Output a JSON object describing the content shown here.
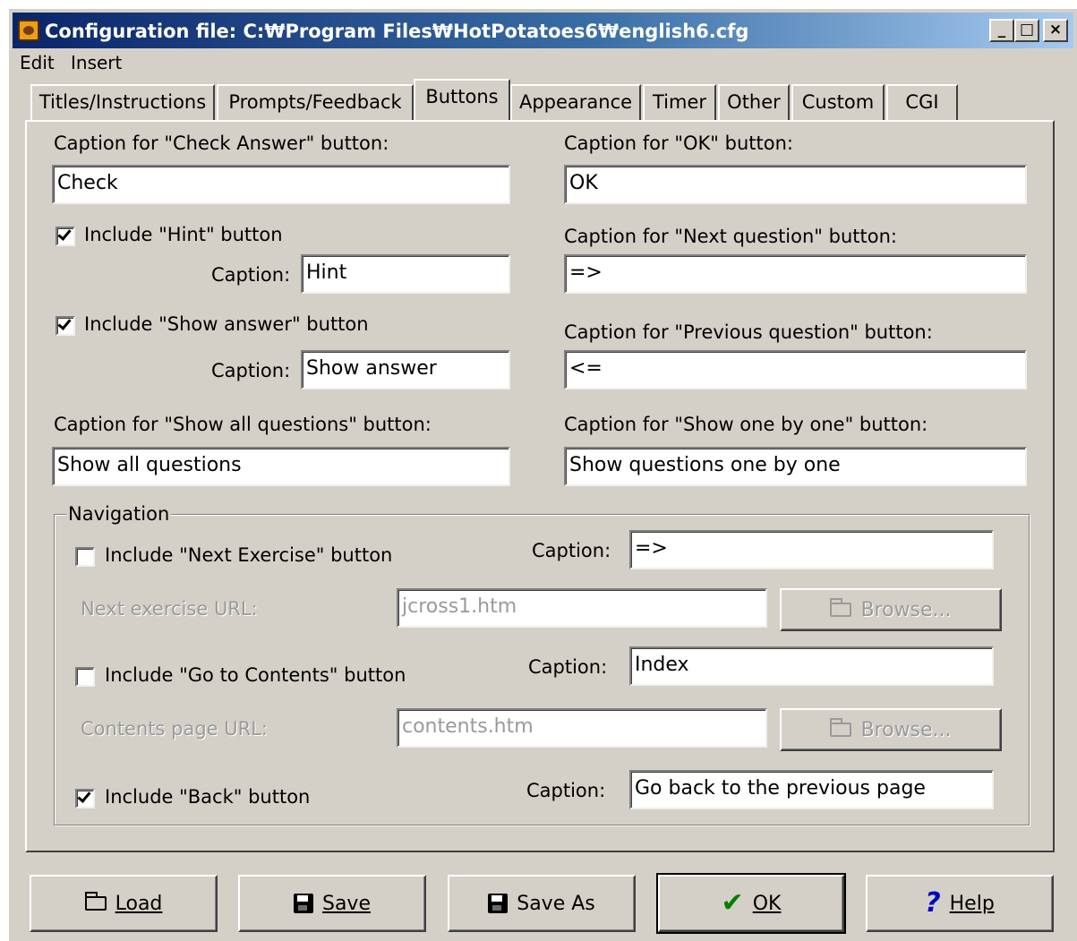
{
  "window": {
    "title": "Configuration file: C:₩Program Files₩HotPotatoes6₩english6.cfg",
    "caption_buttons": {
      "minimize": "_",
      "maximize": "□",
      "close": "×"
    }
  },
  "menu": {
    "edit": "Edit",
    "insert": "Insert"
  },
  "tabs": [
    {
      "label": "Titles/Instructions"
    },
    {
      "label": "Prompts/Feedback"
    },
    {
      "label": "Buttons",
      "active": true
    },
    {
      "label": "Appearance"
    },
    {
      "label": "Timer"
    },
    {
      "label": "Other"
    },
    {
      "label": "Custom"
    },
    {
      "label": "CGI"
    }
  ],
  "buttons_tab": {
    "check_answer": {
      "label": "Caption for \"Check Answer\" button:",
      "value": "Check"
    },
    "hint": {
      "checkbox_label": "Include \"Hint\" button",
      "checked": true,
      "caption_label": "Caption:",
      "value": "Hint"
    },
    "show_answer": {
      "checkbox_label": "Include \"Show answer\" button",
      "checked": true,
      "caption_label": "Caption:",
      "value": "Show answer"
    },
    "show_all": {
      "label": "Caption for \"Show all questions\" button:",
      "value": "Show all questions"
    },
    "ok": {
      "label": "Caption for \"OK\" button:",
      "value": "OK"
    },
    "next_question": {
      "label": "Caption for \"Next question\" button:",
      "value": "=>"
    },
    "previous_question": {
      "label": "Caption for \"Previous question\" button:",
      "value": "<="
    },
    "show_one_by_one": {
      "label": "Caption for \"Show one by one\" button:",
      "value": "Show questions one by one"
    }
  },
  "navigation": {
    "legend": "Navigation",
    "next_exercise": {
      "checkbox_label": "Include \"Next Exercise\" button",
      "checked": false,
      "caption_label": "Caption:",
      "caption_value": "=>",
      "url_label": "Next exercise URL:",
      "url_value": "jcross1.htm",
      "browse_label": "Browse..."
    },
    "contents": {
      "checkbox_label": "Include \"Go to Contents\" button",
      "checked": false,
      "caption_label": "Caption:",
      "caption_value": "Index",
      "url_label": "Contents page URL:",
      "url_value": "contents.htm",
      "browse_label": "Browse..."
    },
    "back": {
      "checkbox_label": "Include \"Back\" button",
      "checked": true,
      "caption_label": "Caption:",
      "caption_value": "Go back to the previous page"
    }
  },
  "footer": {
    "load": "Load",
    "save": "Save",
    "save_as": "Save As",
    "ok": "OK",
    "help": "Help"
  },
  "icons": {
    "ok_check_color": "#008000",
    "help_color": "#0000c0"
  }
}
